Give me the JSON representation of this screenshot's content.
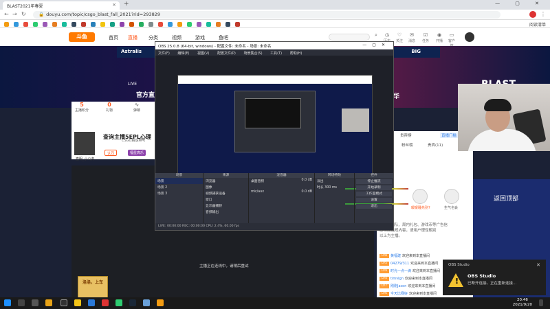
{
  "browser": {
    "tab_title": "BLAST2021年春夏",
    "url": "douyu.com/topic/csgo_blast_fall_2021?rid=293829",
    "bookmarks_right": "阅读清单",
    "window_controls": "— ▢ ✕"
  },
  "site": {
    "logo": "斗鱼",
    "nav": [
      "首页",
      "直播",
      "分类",
      "视频",
      "游戏",
      "鱼吧"
    ],
    "active_nav": "直播",
    "top_icons": [
      {
        "icon": "history-icon",
        "label": "历史"
      },
      {
        "icon": "follow-icon",
        "label": "关注"
      },
      {
        "icon": "message-icon",
        "label": "消息"
      },
      {
        "icon": "task-icon",
        "label": "任务"
      },
      {
        "icon": "live-icon",
        "label": "开播"
      },
      {
        "icon": "client-icon",
        "label": "客户端"
      }
    ]
  },
  "banner": {
    "left_team": "Astralis",
    "right_team": "BIG",
    "brand": "BLAST",
    "live": "LIVE",
    "live_title": "官方直",
    "suffix": "华"
  },
  "anchor": {
    "title": "查询主播5EPL心理",
    "name": "查明_小公务",
    "tag1": "认同",
    "tag2": "CSGO解说带号",
    "tag3": "福星高乐",
    "stats": [
      {
        "value": "5",
        "label": "主播积分"
      },
      {
        "value": "0",
        "label": "礼物"
      },
      {
        "value": "",
        "label": "弹幕"
      }
    ]
  },
  "video": {
    "notice": "主播正在连线中，请稍后重试",
    "promo": "洛洛，上车"
  },
  "side": {
    "tabs": [
      "贵宾榜",
      "粉丝榜",
      "贵宾(11)"
    ],
    "top_button": "直播门槛",
    "pk_label": "PO",
    "gift_users": [
      "暖暖睡先别?",
      "生气也会"
    ],
    "notice_lines": [
      "好友、团队、周内礼包、游戏币等广告信",
      "息以及违规内容，请用户理性甄别",
      "以上为主播。"
    ],
    "chat": [
      {
        "lv": "LV8",
        "name": "黄福建",
        "text": "欢迎来到本直播间"
      },
      {
        "lv": "LV5",
        "name": "04279/311",
        "text": "欢迎来到本直播间"
      },
      {
        "lv": "LV9",
        "name": "时光一点一滴",
        "text": "欢迎来到本直播间"
      },
      {
        "lv": "LV4",
        "name": "timvlgn",
        "text": "欢迎来到本直播间"
      },
      {
        "lv": "LV7",
        "name": "刚刚Jason",
        "text": "欢迎来到本直播间"
      },
      {
        "lv": "LV6",
        "name": "今天比赛好",
        "text": "欢迎来到本直播间"
      },
      {
        "lv": "LV8",
        "name": "Jason C0",
        "text": "欢迎来到本直播间"
      },
      {
        "lv": "LV5",
        "name": "白质黑流Archie",
        "text": "欢迎来到本直播间"
      }
    ]
  },
  "back_to_top": "返回顶部",
  "obs": {
    "title": "OBS 25.0.8 (64-bit, windows) - 配置文件: 未命名 - 场景: 未命名",
    "menu": [
      "文件(F)",
      "编辑(E)",
      "视图(V)",
      "配置文件(P)",
      "场景集合(S)",
      "工具(T)",
      "帮助(H)"
    ],
    "panels": {
      "scenes": "场景",
      "sources": "来源",
      "mixer": "混音器",
      "transitions": "转场特效",
      "controls": "控件"
    },
    "scene_list": [
      "场景",
      "场景 2",
      "场景 3"
    ],
    "source_list": [
      "浏览器",
      "图像",
      "视频捕获设备",
      "窗口",
      "显示器捕获",
      "音频输出"
    ],
    "mixer_items": [
      "桌面音频",
      "mic/aux",
      "视频捕获设备"
    ],
    "mixer_values": [
      "0.0 dB",
      "0.0 dB",
      "0.0 dB"
    ],
    "transition": "淡出",
    "duration_label": "时长",
    "duration": "300 ms",
    "control_buttons": [
      "停止推流",
      "开始录制",
      "工作室模式",
      "设置",
      "退出"
    ],
    "status": "LIVE: 00:00:00    REC: 00:00:00    CPU: 2.4%, 60.00 fps"
  },
  "toast": {
    "app": "OBS Studio",
    "title": "OBS Studio",
    "body": "已断开连接。正在重新连接..."
  },
  "clock": {
    "time": "20:46",
    "date": "2021/9/20"
  }
}
